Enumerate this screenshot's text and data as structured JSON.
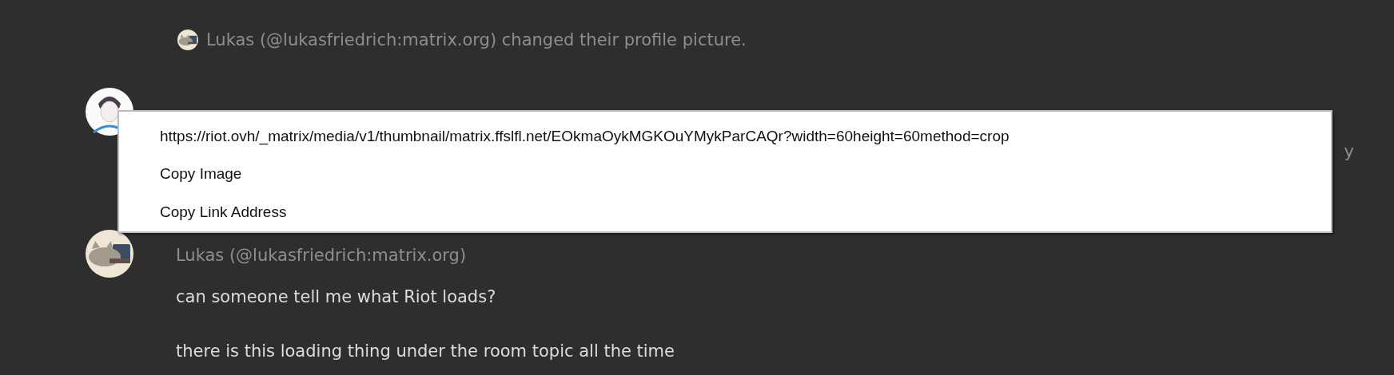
{
  "timeline": [
    {
      "kind": "membership",
      "text": "Lukas (@lukasfriedrich:matrix.org) changed their profile picture.",
      "avatar": {
        "kind": "cat"
      }
    },
    {
      "kind": "message",
      "avatar": {
        "kind": "person"
      },
      "body": [
        "y"
      ]
    },
    {
      "kind": "message",
      "sender": "Lukas (@lukasfriedrich:matrix.org)",
      "avatar": {
        "kind": "cat"
      },
      "body": [
        "can someone tell me what Riot loads?",
        "there is this loading thing under the room topic all the time"
      ]
    }
  ],
  "context_menu": {
    "items": [
      "https://riot.ovh/_matrix/media/v1/thumbnail/matrix.ffslfl.net/EOkmaOykMGKOuYMykParCAQr?width=60height=60method=crop",
      "Copy Image",
      "Copy Link Address"
    ]
  }
}
